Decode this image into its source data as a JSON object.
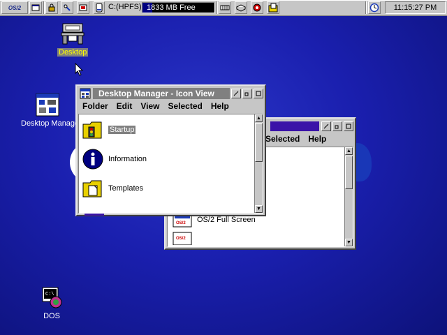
{
  "warpcenter": {
    "logo_text": "OS/2",
    "drive": "C:(HPFS)",
    "free_space": "1833 MB Free",
    "clock": "11:15:27 PM"
  },
  "desktop_icons": {
    "desktop": "Desktop",
    "desktop_manager": "Desktop Manager",
    "dos": "DOS"
  },
  "main_window": {
    "title": "Desktop Manager - Icon View",
    "menu": [
      "Folder",
      "Edit",
      "View",
      "Selected",
      "Help"
    ],
    "objects": [
      "Startup",
      "Information",
      "Templates"
    ]
  },
  "back_window": {
    "menu": [
      "Selected",
      "Help"
    ],
    "objects": [
      "OS/2 Full Screen"
    ]
  },
  "colors": {
    "desktop_bg": "#1a1fae",
    "titlebar_active": "#808080",
    "titlebar_inactive": "#c6c6c6",
    "back_title_accent": "#3a13a8",
    "selection_label": "#808080"
  }
}
